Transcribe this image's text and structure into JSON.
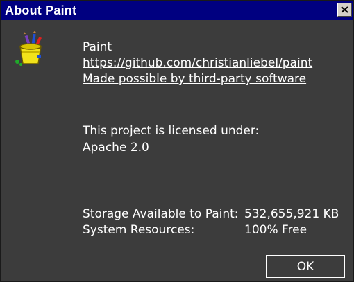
{
  "window": {
    "title": "About Paint",
    "close_icon": "close-icon"
  },
  "app": {
    "icon": "paint-bucket-icon",
    "name": "Paint",
    "repo_link": "https://github.com/christianliebel/paint",
    "third_party_link": "Made possible by third-party software"
  },
  "license": {
    "intro": "This project is licensed under:",
    "name": "Apache 2.0"
  },
  "stats": [
    {
      "label": "Storage Available to Paint:",
      "value": "532,655,921 KB"
    },
    {
      "label": "System Resources:",
      "value": "100% Free"
    }
  ],
  "buttons": {
    "ok_label": "OK"
  },
  "colors": {
    "titlebar": "#000080",
    "background": "#3c3c3c",
    "text": "#ffffff"
  }
}
